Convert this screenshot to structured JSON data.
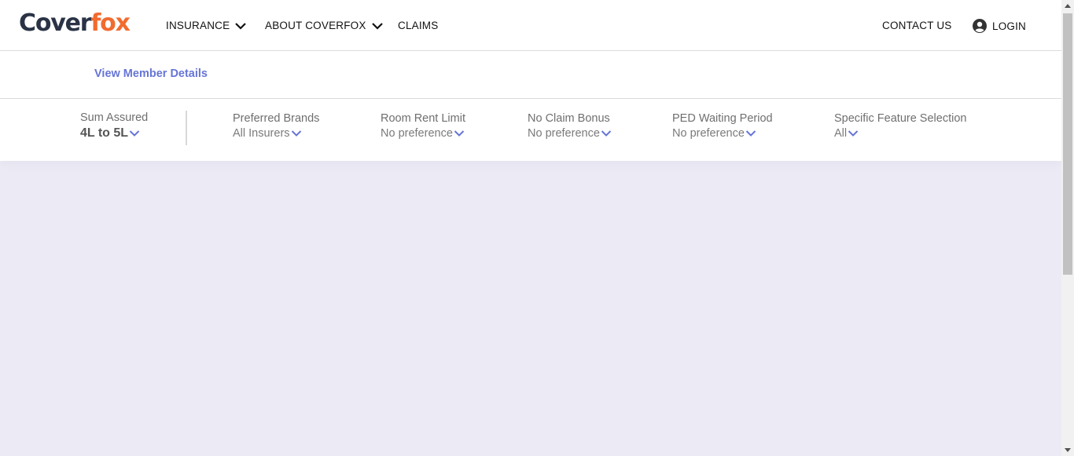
{
  "header": {
    "logo": {
      "part1": "Cover",
      "part2": "fox"
    },
    "nav": {
      "insurance": "INSURANCE",
      "about": "ABOUT COVERFOX",
      "claims": "CLAIMS",
      "contact": "CONTACT US",
      "login": "LOGIN"
    }
  },
  "subheader": {
    "member_link": "View Member Details"
  },
  "filters": {
    "sum_assured": {
      "label": "Sum Assured",
      "value": "4L to 5L"
    },
    "preferred_brands": {
      "label": "Preferred Brands",
      "value": "All Insurers"
    },
    "room_rent": {
      "label": "Room Rent Limit",
      "value": "No preference"
    },
    "no_claim_bonus": {
      "label": "No Claim Bonus",
      "value": "No preference"
    },
    "ped_waiting": {
      "label": "PED Waiting Period",
      "value": "No preference"
    },
    "specific_feature": {
      "label": "Specific Feature Selection",
      "value": "All"
    }
  },
  "colors": {
    "brand_dark": "#2a3346",
    "brand_orange": "#f26b2f",
    "accent_link": "#6675d6",
    "page_background": "#ecebf5"
  },
  "icons": {
    "nav_dropdown": "chevron-down-icon",
    "login": "user-circle-icon",
    "filter_dropdown": "chevron-down-icon"
  }
}
